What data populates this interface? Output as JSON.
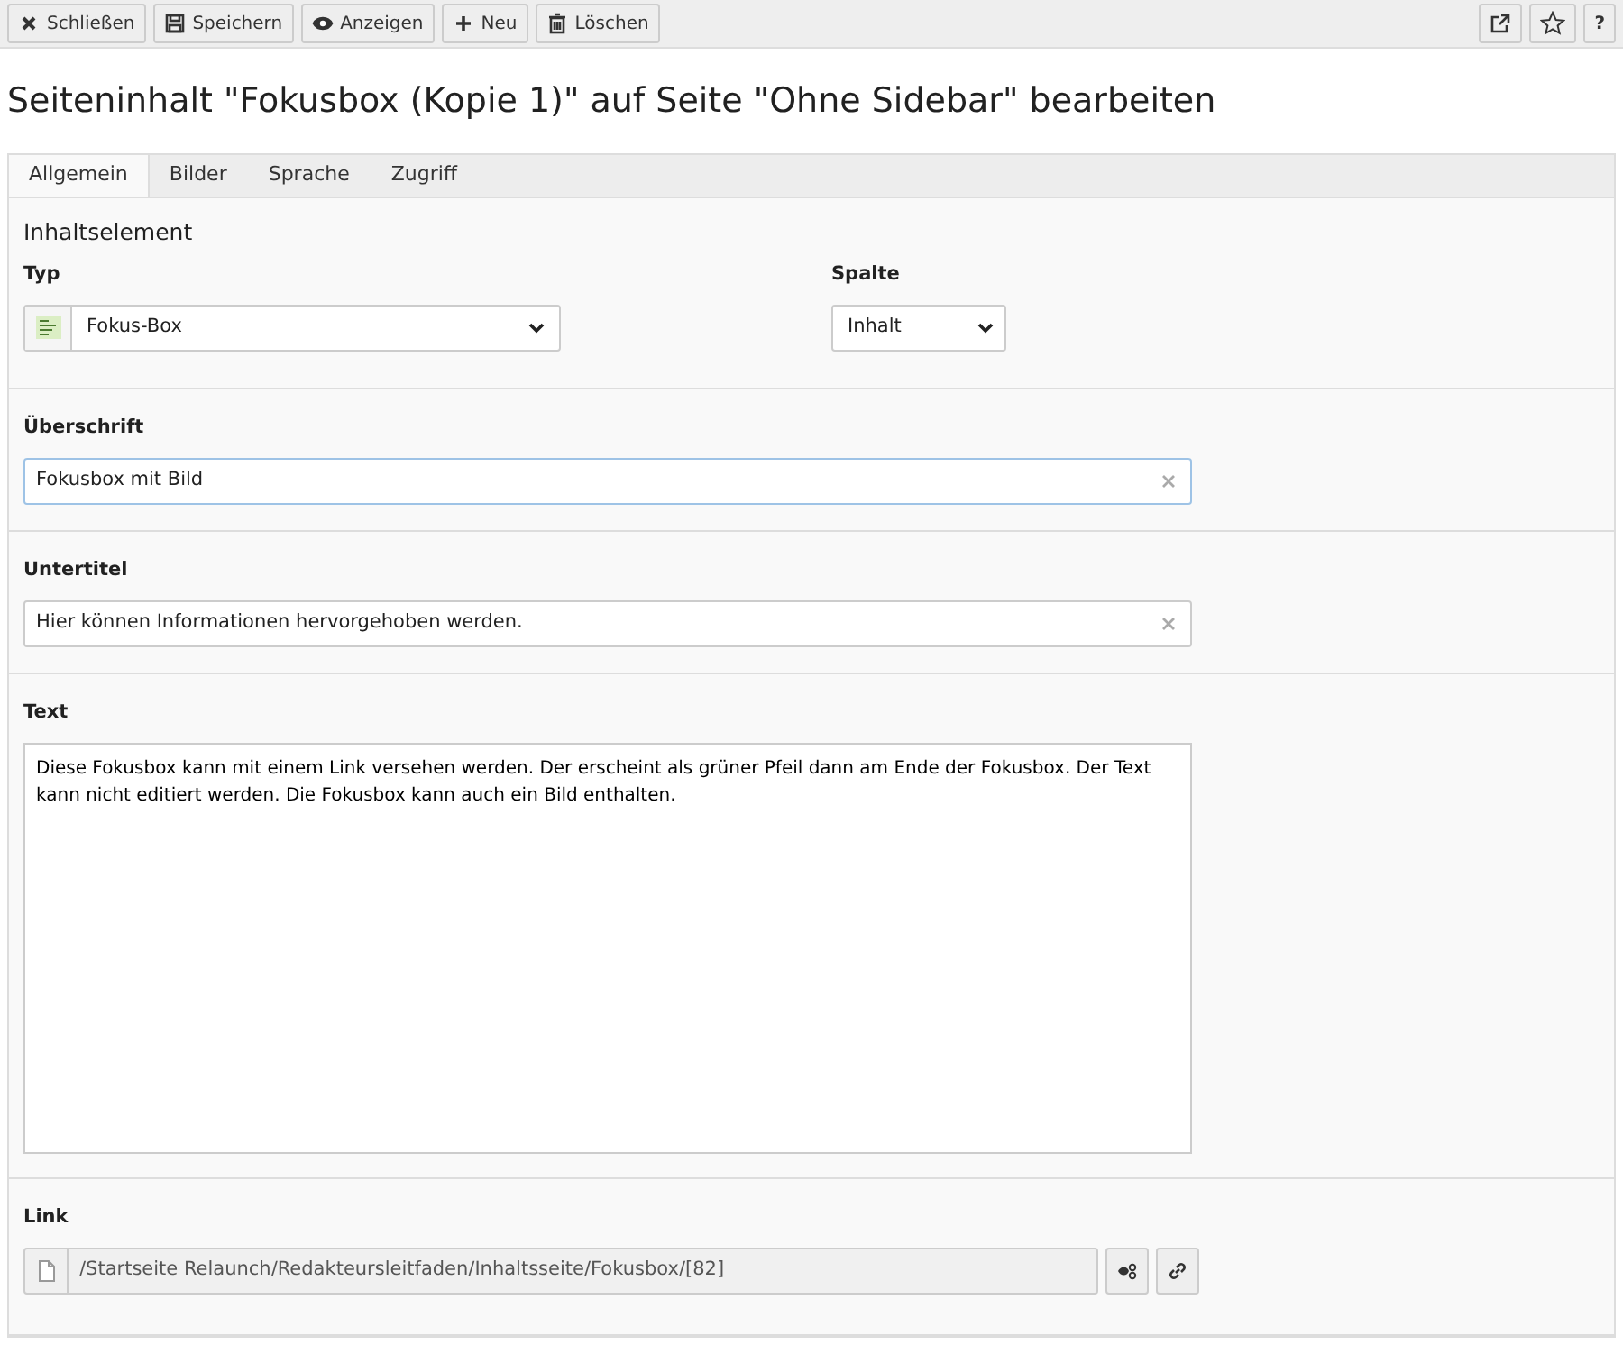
{
  "toolbar": {
    "left": [
      {
        "kind": "close",
        "label": "Schließen"
      },
      {
        "kind": "save",
        "label": "Speichern"
      },
      {
        "kind": "view",
        "label": "Anzeigen"
      },
      {
        "kind": "new",
        "label": "Neu"
      },
      {
        "kind": "delete",
        "label": "Löschen"
      }
    ],
    "right": [
      {
        "kind": "external"
      },
      {
        "kind": "star"
      },
      {
        "kind": "text",
        "label": "?"
      }
    ]
  },
  "title": "Seiteninhalt \"Fokusbox (Kopie 1)\" auf Seite \"Ohne Sidebar\" bearbeiten",
  "tabs": [
    {
      "label": "Allgemein",
      "selected": true
    },
    {
      "label": "Bilder",
      "selected": false
    },
    {
      "label": "Sprache",
      "selected": false
    },
    {
      "label": "Zugriff",
      "selected": false
    }
  ],
  "element_section": {
    "heading": "Inhaltselement",
    "type_label": "Typ",
    "type_value": "Fokus-Box",
    "column_label": "Spalte",
    "column_value": "Inhalt"
  },
  "fields": [
    {
      "kind": "input",
      "label": "Überschrift",
      "value": "Fokusbox mit Bild",
      "focused": true
    },
    {
      "kind": "input",
      "label": "Untertitel",
      "value": "Hier können Informationen hervorgehoben werden.",
      "focused": false
    },
    {
      "kind": "textarea",
      "label": "Text",
      "value": "Diese Fokusbox kann mit einem Link versehen werden. Der erscheint als grüner Pfeil dann am Ende der Fokusbox. Der Text kann nicht editiert werden. Die Fokusbox kann auch ein Bild enthalten.",
      "focused": false
    },
    {
      "kind": "link",
      "label": "Link",
      "value": "/Startseite Relaunch/Redakteursleitfaden/Inhaltsseite/Fokusbox/[82]",
      "focused": false
    }
  ]
}
